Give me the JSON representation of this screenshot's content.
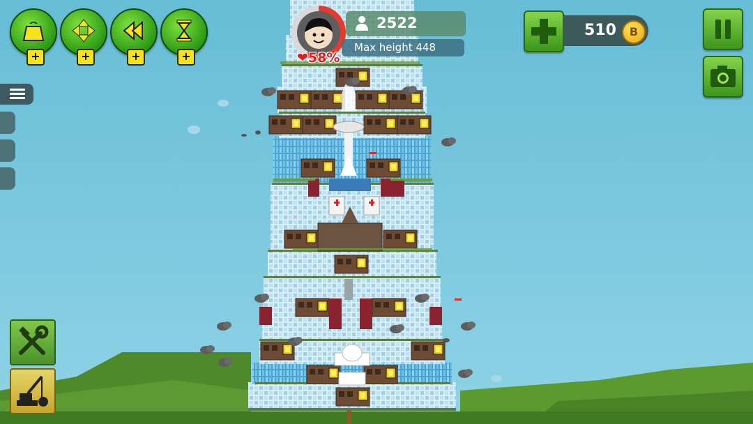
{
  "powerups": [
    {
      "icon": "weight-icon",
      "plus": "+"
    },
    {
      "icon": "move-arrows-icon",
      "plus": "+"
    },
    {
      "icon": "rewind-icon",
      "plus": "+"
    },
    {
      "icon": "hourglass-icon",
      "plus": "+"
    }
  ],
  "player": {
    "health_text": "❤58%",
    "health_fraction": 0.58,
    "population": "2522",
    "max_height_label": "Max height 448"
  },
  "coins": {
    "value": "510",
    "symbol": "B"
  },
  "colors": {
    "sky": "#6fc3da",
    "button_green": "#4caf25",
    "health_red": "#e01d1d",
    "coin_gold": "#f0b418"
  }
}
